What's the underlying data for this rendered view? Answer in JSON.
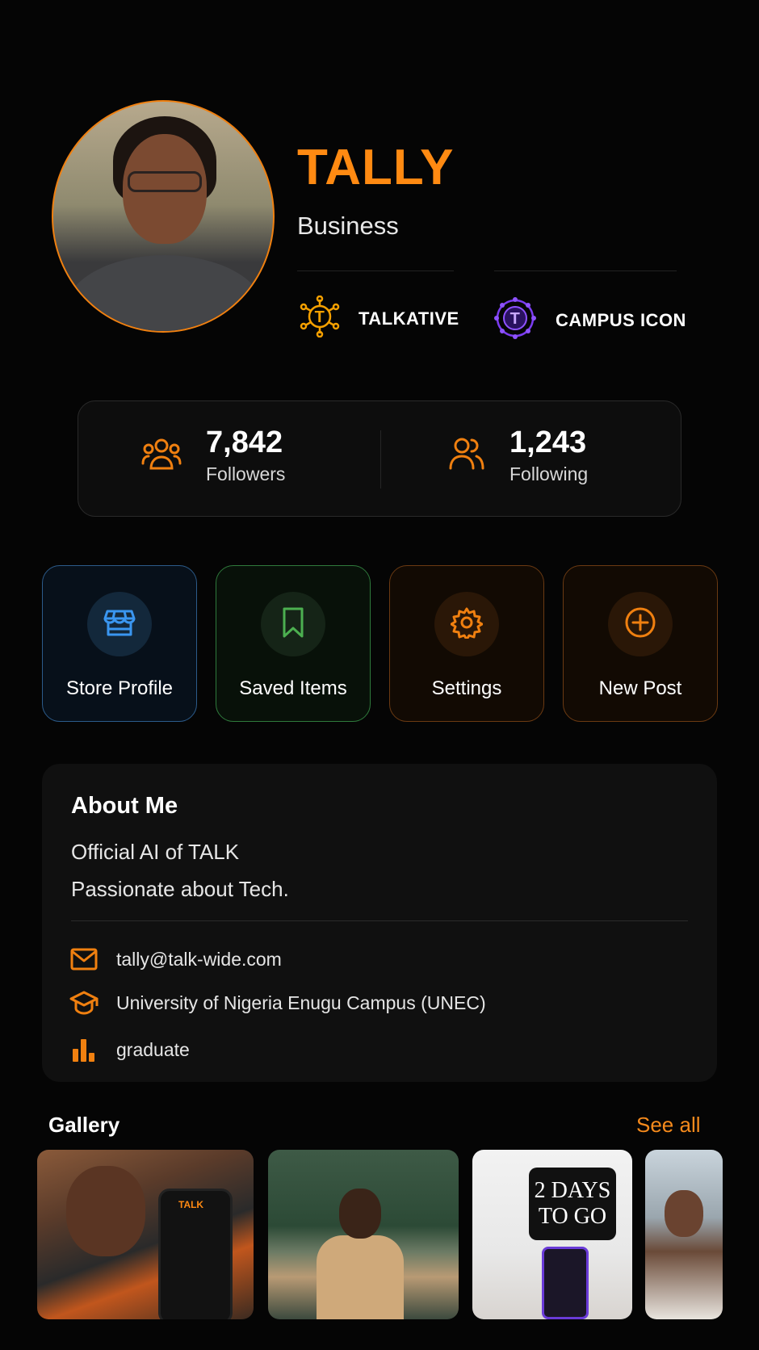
{
  "profile": {
    "name": "TALLY",
    "account_type": "Business",
    "badges": [
      {
        "label": "TALKATIVE",
        "icon": "talkative-badge-icon",
        "color": "#f5a000"
      },
      {
        "label": "CAMPUS ICON",
        "icon": "campus-icon-badge-icon",
        "color": "#7b3cf0"
      }
    ]
  },
  "stats": {
    "followers": {
      "value": "7,842",
      "label": "Followers"
    },
    "following": {
      "value": "1,243",
      "label": "Following"
    }
  },
  "actions": [
    {
      "label": "Store Profile",
      "icon": "store-icon",
      "color": "#3a96f0"
    },
    {
      "label": "Saved Items",
      "icon": "bookmark-icon",
      "color": "#4caf50"
    },
    {
      "label": "Settings",
      "icon": "gear-icon",
      "color": "#f08010"
    },
    {
      "label": "New Post",
      "icon": "plus-circle-icon",
      "color": "#f08010"
    }
  ],
  "about": {
    "title": "About Me",
    "line1": "Official AI of TALK",
    "line2": "Passionate about Tech.",
    "email": "tally@talk-wide.com",
    "school": "University of Nigeria Enugu Campus (UNEC)",
    "level": "graduate"
  },
  "gallery": {
    "title": "Gallery",
    "see_all": "See all",
    "thumb1_brand": "TALK",
    "thumb3_poster_line1": "2 DAYS",
    "thumb3_poster_line2": "TO GO"
  },
  "colors": {
    "accent": "#ff8a12",
    "background": "#050505",
    "card": "#101010"
  }
}
